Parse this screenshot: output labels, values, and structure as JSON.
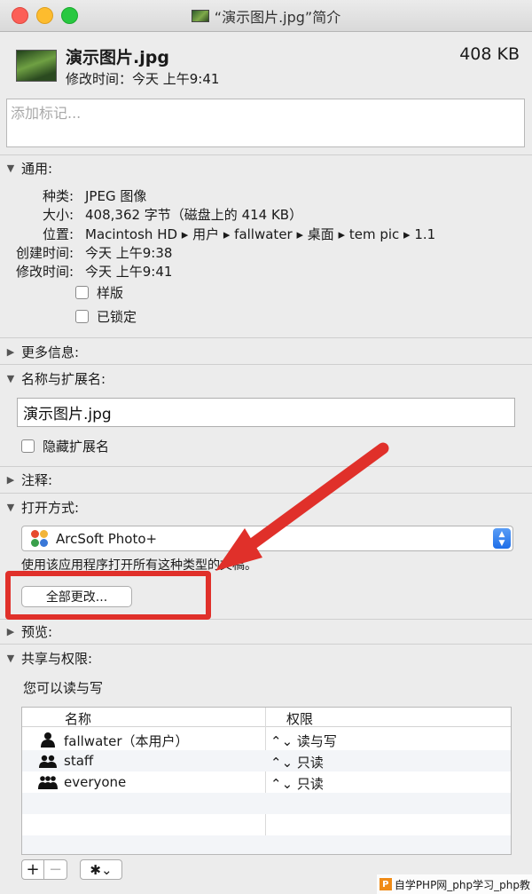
{
  "window": {
    "title": "“演示图片.jpg”简介"
  },
  "header": {
    "file_name": "演示图片.jpg",
    "file_size": "408 KB",
    "modified": "修改时间：今天 上午9:41"
  },
  "tags": {
    "placeholder": "添加标记..."
  },
  "general": {
    "title": "通用:",
    "rows": [
      {
        "key": "种类:",
        "value": "JPEG 图像"
      },
      {
        "key": "大小:",
        "value": "408,362 字节（磁盘上的 414 KB）"
      },
      {
        "key": "位置:",
        "value": "Macintosh HD ▸ 用户 ▸ fallwater ▸ 桌面 ▸ tem pic ▸ 1.1"
      },
      {
        "key": "创建时间:",
        "value": "今天 上午9:38"
      },
      {
        "key": "修改时间:",
        "value": "今天 上午9:41"
      }
    ],
    "stationery_label": "样版",
    "locked_label": "已锁定"
  },
  "more_info": {
    "title": "更多信息:"
  },
  "name_ext": {
    "title": "名称与扩展名:",
    "value": "演示图片.jpg",
    "hide_ext_label": "隐藏扩展名"
  },
  "comments": {
    "title": "注释:"
  },
  "open_with": {
    "title": "打开方式:",
    "app": "ArcSoft Photo+",
    "description": "使用该应用程序打开所有这种类型的文稿。",
    "change_all_label": "全部更改..."
  },
  "preview": {
    "title": "预览:"
  },
  "sharing": {
    "title": "共享与权限:",
    "note": "您可以读与写",
    "col_name": "名称",
    "col_priv": "权限",
    "rows": [
      {
        "name": "fallwater（本用户）",
        "priv": "读与写",
        "icon": "single-user-icon"
      },
      {
        "name": "staff",
        "priv": "只读",
        "icon": "group-icon"
      },
      {
        "name": "everyone",
        "priv": "只读",
        "icon": "everyone-icon"
      }
    ]
  },
  "toolbar": {
    "add_label": "+",
    "remove_label": "−",
    "gear_label": "✱⌄"
  },
  "watermark": {
    "logo_text": "P",
    "text": "自学PHP网_php学习_php教"
  },
  "glyphs": {
    "expanded": "▼",
    "collapsed": "▶",
    "updown": "⌃⌄"
  },
  "colors": {
    "annotation_red": "#e0302a",
    "accent_blue": "#1e6ee8"
  }
}
